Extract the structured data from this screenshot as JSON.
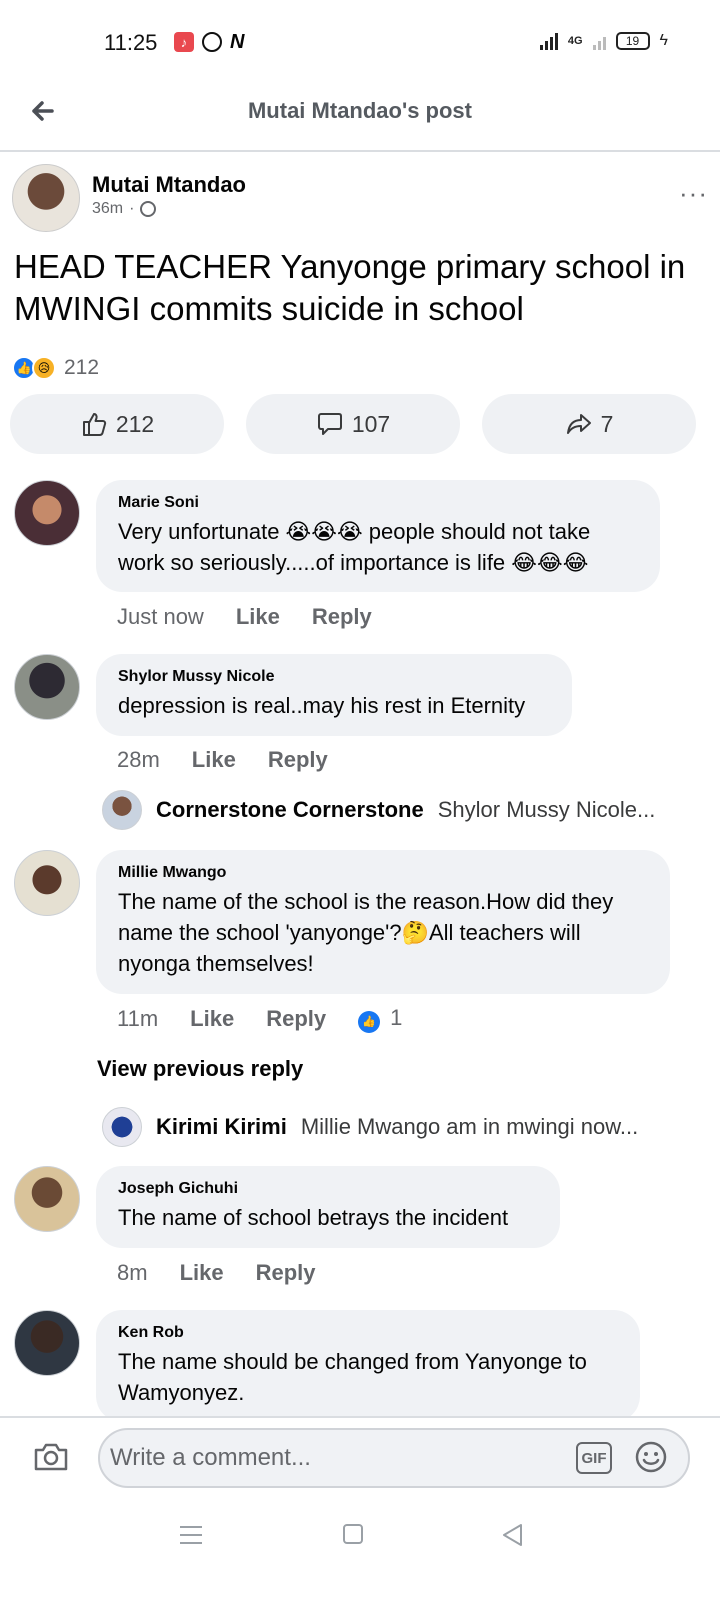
{
  "status_bar": {
    "time": "11:25",
    "app_n": "N",
    "network": "4G",
    "battery": "19"
  },
  "header": {
    "title": "Mutai Mtandao's post"
  },
  "post": {
    "author": "Mutai Mtandao",
    "time": "36m",
    "separator": "·",
    "more": "···",
    "text": "HEAD TEACHER Yanyonge primary school in MWINGI commits suicide in school",
    "reaction_count": "212",
    "actions": {
      "like_count": "212",
      "comment_count": "107",
      "share_count": "7"
    }
  },
  "comments": [
    {
      "name": "Marie Soni",
      "text": "Very unfortunate 😭😭😭 people should not take work so seriously.....of importance is life 😂😂😂",
      "time": "Just now",
      "like": "Like",
      "reply": "Reply"
    },
    {
      "name": "Shylor Mussy Nicole",
      "text": "depression is real..may his rest in Eternity",
      "time": "28m",
      "like": "Like",
      "reply": "Reply",
      "reply_preview": {
        "name": "Cornerstone Cornerstone",
        "text": "Shylor Mussy Nicole..."
      }
    },
    {
      "name": "Millie Mwango",
      "text": "The name of the school is the reason.How did they name the school 'yanyonge'?🤔All teachers will nyonga themselves!",
      "time": "11m",
      "like": "Like",
      "reply": "Reply",
      "like_count": "1",
      "view_previous": "View previous reply",
      "reply_preview": {
        "name": "Kirimi Kirimi",
        "text": "Millie Mwango am in mwingi now..."
      }
    },
    {
      "name": "Joseph Gichuhi",
      "text": "The name of school betrays the incident",
      "time": "8m",
      "like": "Like",
      "reply": "Reply"
    },
    {
      "name": "Ken Rob",
      "text": "The name should be changed from Yanyonge to Wamyonyez."
    }
  ],
  "composer": {
    "placeholder": "Write a comment...",
    "gif": "GIF"
  },
  "colors": {
    "facebook_blue": "#1877f2",
    "bubble_gray": "#f0f2f5",
    "secondary_text": "#65676b"
  }
}
